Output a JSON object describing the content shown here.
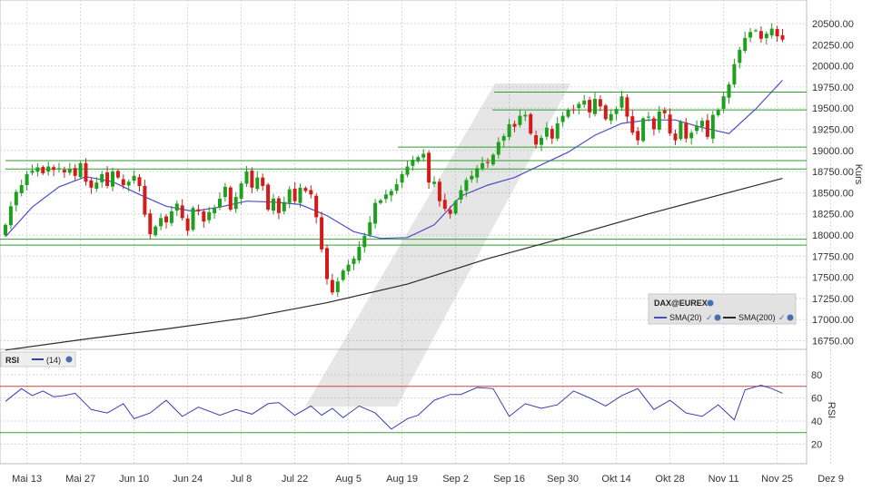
{
  "chart_data": [
    {
      "type": "candlestick",
      "instrument": "DAX@EUREX",
      "ylabel": "Kurs",
      "ylim": [
        16600,
        20600
      ],
      "yticks": [
        16750,
        17000,
        17250,
        17500,
        17750,
        18000,
        18250,
        18500,
        18750,
        19000,
        19250,
        19500,
        19750,
        20000,
        20250,
        20500
      ],
      "ytick_labels": [
        "16750.00",
        "17000.00",
        "17250.00",
        "17500.00",
        "17750.00",
        "18000.00",
        "18250.00",
        "18500.00",
        "18750.00",
        "19000.00",
        "19250.00",
        "19500.00",
        "19750.00",
        "20000.00",
        "20250.00",
        "20500.00"
      ],
      "xtick_labels": [
        "Mai 13",
        "Mai 27",
        "Jun 10",
        "Jun 24",
        "Jul 8",
        "Jul 22",
        "Aug 5",
        "Aug 19",
        "Sep 2",
        "Sep 16",
        "Sep 30",
        "Okt 14",
        "Okt 28",
        "Nov 11",
        "Nov 25",
        "Dez 9"
      ],
      "grid": true,
      "close": [
        18120,
        18340,
        18510,
        18590,
        18720,
        18760,
        18800,
        18730,
        18810,
        18770,
        18790,
        18740,
        18780,
        18700,
        18850,
        18630,
        18560,
        18620,
        18720,
        18580,
        18750,
        18680,
        18590,
        18630,
        18700,
        18580,
        18240,
        18010,
        18100,
        18200,
        18150,
        18280,
        18370,
        18200,
        18050,
        18320,
        18280,
        18160,
        18270,
        18320,
        18430,
        18570,
        18300,
        18450,
        18610,
        18750,
        18560,
        18680,
        18580,
        18300,
        18430,
        18260,
        18390,
        18540,
        18400,
        18560,
        18520,
        18480,
        18210,
        17830,
        17480,
        17320,
        17450,
        17580,
        17650,
        17720,
        17860,
        17990,
        18150,
        18380,
        18410,
        18480,
        18520,
        18600,
        18720,
        18810,
        18890,
        18920,
        18960,
        18620,
        18630,
        18400,
        18310,
        18250,
        18400,
        18530,
        18650,
        18700,
        18790,
        18850,
        18850,
        18950,
        19100,
        19170,
        19310,
        19280,
        19410,
        19420,
        19200,
        19070,
        19150,
        19270,
        19140,
        19320,
        19410,
        19480,
        19480,
        19550,
        19590,
        19450,
        19610,
        19520,
        19370,
        19430,
        19490,
        19640,
        19400,
        19210,
        19120,
        19380,
        19400,
        19250,
        19460,
        19440,
        19200,
        19120,
        19340,
        19140,
        19210,
        19290,
        19350,
        19160,
        19420,
        19480,
        19640,
        19780,
        20020,
        20190,
        20330,
        20400,
        20420,
        20320,
        20380,
        20440,
        20350,
        20310
      ],
      "series": [
        {
          "name": "SMA(20)",
          "color": "#4b4dc8",
          "x": [
            0,
            5,
            10,
            15,
            20,
            25,
            30,
            35,
            40,
            45,
            50,
            55,
            60,
            65,
            70,
            75,
            80,
            85,
            90,
            95,
            100,
            105,
            110,
            115,
            120,
            125,
            130,
            135,
            140,
            145
          ],
          "values": [
            17980,
            18330,
            18570,
            18690,
            18630,
            18480,
            18340,
            18280,
            18330,
            18400,
            18390,
            18360,
            18230,
            18040,
            17960,
            17970,
            18120,
            18460,
            18590,
            18680,
            18830,
            18980,
            19180,
            19320,
            19360,
            19360,
            19270,
            19200,
            19490,
            19830
          ]
        },
        {
          "name": "SMA(200)",
          "color": "#2a2a2a",
          "x": [
            0,
            15,
            30,
            45,
            60,
            75,
            90,
            105,
            120,
            130,
            145
          ],
          "values": [
            16640,
            16770,
            16890,
            17020,
            17200,
            17420,
            17720,
            17980,
            18250,
            18420,
            18670
          ]
        }
      ],
      "horizontal_lines": [
        17880,
        17950,
        18780,
        18880,
        19040,
        19480,
        19690
      ]
    },
    {
      "type": "line",
      "indicator": "RSI",
      "legend_label": "(14)",
      "ylabel": "RSI",
      "ylim": [
        10,
        90
      ],
      "yticks": [
        20,
        40,
        60,
        80
      ],
      "ytick_labels": [
        "20",
        "40",
        "60",
        "80"
      ],
      "reference_lines": [
        70,
        30
      ],
      "x": [
        0,
        3,
        5,
        7,
        9,
        11,
        13,
        16,
        19,
        22,
        24,
        27,
        30,
        33,
        36,
        40,
        43,
        46,
        49,
        51,
        54,
        57,
        59,
        61,
        63,
        66,
        69,
        72,
        75,
        77,
        80,
        83,
        85,
        88,
        91,
        94,
        97,
        100,
        103,
        106,
        109,
        112,
        115,
        118,
        121,
        124,
        127,
        130,
        133,
        136,
        138,
        141,
        143,
        145
      ],
      "values": [
        57,
        68,
        62,
        66,
        61,
        62,
        64,
        50,
        47,
        55,
        42,
        47,
        58,
        44,
        52,
        45,
        50,
        46,
        55,
        56,
        45,
        53,
        45,
        51,
        43,
        53,
        47,
        33,
        42,
        45,
        58,
        63,
        63,
        69,
        68,
        44,
        55,
        51,
        54,
        66,
        60,
        53,
        62,
        68,
        50,
        58,
        47,
        44,
        54,
        41,
        67,
        71,
        68,
        64
      ]
    }
  ],
  "watermark": "bar-logo",
  "colors": {
    "up": "#1ea01e",
    "down": "#d21c1c",
    "sma20": "#4b4dc8",
    "sma200": "#2a2a2a",
    "support": "#2f9e2f",
    "rsi_line": "#3a3fb0",
    "rsi_upper": "#cc4444",
    "rsi_lower": "#3aa03a"
  },
  "legend": {
    "title": "DAX@EUREX",
    "sma20": "SMA(20)",
    "sma200": "SMA(200)",
    "check": "✓"
  },
  "rsi_legend": {
    "label": "RSI",
    "period": "(14)"
  }
}
